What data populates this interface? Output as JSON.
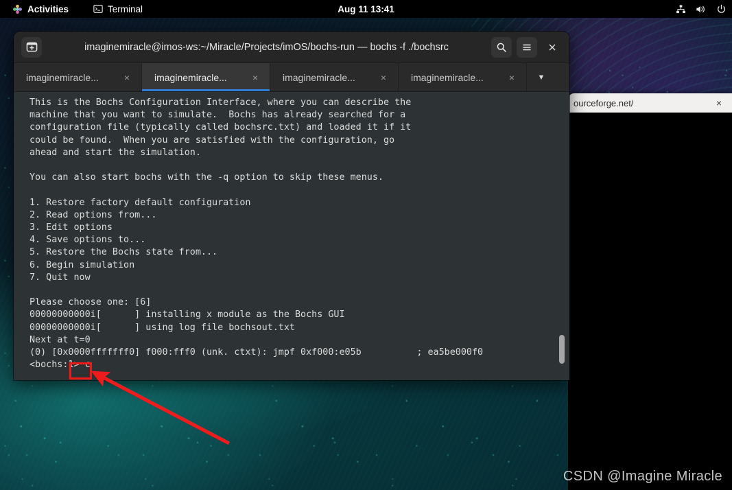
{
  "topbar": {
    "activities": "Activities",
    "app_name": "Terminal",
    "clock": "Aug 11 13:41",
    "icons": {
      "gnome": "gnome-activities-icon",
      "terminal": "terminal-icon",
      "network": "network-wired-icon",
      "volume": "volume-icon",
      "power": "power-icon"
    }
  },
  "terminal": {
    "title": "imaginemiracle@imos-ws:~/Miracle/Projects/imOS/bochs-run — bochs -f ./bochsrc",
    "new_tab_label": "new-terminal",
    "search_label": "Search",
    "menu_label": "Menu",
    "close_label": "×",
    "tabs": [
      {
        "label": "imaginemiracle...",
        "close": "×",
        "active": false
      },
      {
        "label": "imaginemiracle...",
        "close": "×",
        "active": true
      },
      {
        "label": "imaginemiracle...",
        "close": "×",
        "active": false
      },
      {
        "label": "imaginemiracle...",
        "close": "×",
        "active": false
      }
    ],
    "tabs_overflow": "▼",
    "content": "This is the Bochs Configuration Interface, where you can describe the\nmachine that you want to simulate.  Bochs has already searched for a\nconfiguration file (typically called bochsrc.txt) and loaded it if it\ncould be found.  When you are satisfied with the configuration, go\nahead and start the simulation.\n\nYou can also start bochs with the -q option to skip these menus.\n\n1. Restore factory default configuration\n2. Read options from...\n3. Edit options\n4. Save options to...\n5. Restore the Bochs state from...\n6. Begin simulation\n7. Quit now\n\nPlease choose one: [6]\n00000000000i[      ] installing x module as the Bochs GUI\n00000000000i[      ] using log file bochsout.txt\nNext at t=0\n(0) [0x0000fffffff0] f000:fff0 (unk. ctxt): jmpf 0xf000:e05b          ; ea5be000f0\n<bochs:1> c"
  },
  "browser": {
    "url": "ourceforge.net/",
    "close": "×"
  },
  "annotation": {
    "highlight_target": "c",
    "box_color": "#f31717",
    "arrow_color": "#ee1c1c"
  },
  "watermark": "CSDN @Imagine Miracle"
}
